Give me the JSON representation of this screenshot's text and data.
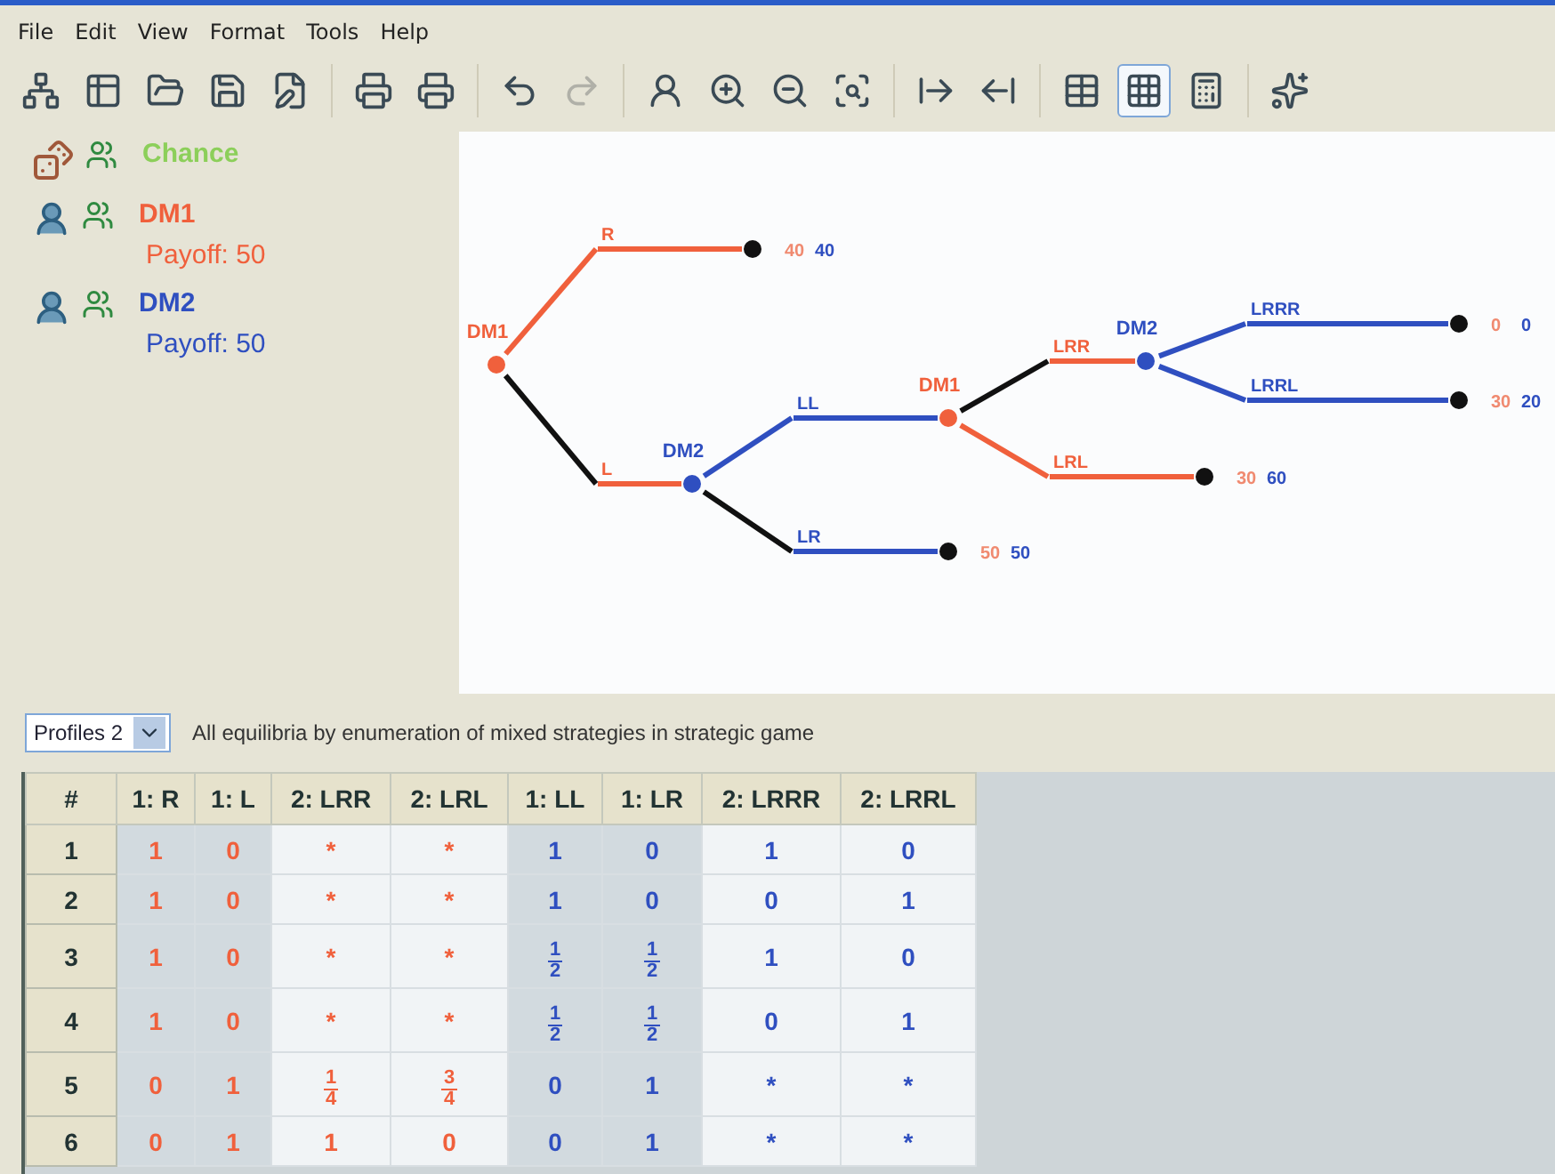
{
  "menu": [
    "File",
    "Edit",
    "View",
    "Format",
    "Tools",
    "Help"
  ],
  "toolbar": {
    "groups": [
      {
        "buttons": [
          {
            "kind": "logo",
            "selected": false,
            "disabled": false
          },
          {
            "kind": "new",
            "selected": false,
            "disabled": false
          },
          {
            "kind": "open",
            "selected": false,
            "disabled": false
          },
          {
            "kind": "save",
            "selected": false,
            "disabled": false
          },
          {
            "kind": "save-as",
            "selected": false,
            "disabled": false
          }
        ]
      },
      {
        "buttons": [
          {
            "kind": "print",
            "selected": false,
            "disabled": false
          },
          {
            "kind": "print-preview",
            "selected": false,
            "disabled": false
          }
        ]
      },
      {
        "buttons": [
          {
            "kind": "undo",
            "selected": false,
            "disabled": false
          },
          {
            "kind": "redo",
            "selected": false,
            "disabled": true
          }
        ]
      },
      {
        "buttons": [
          {
            "kind": "player",
            "selected": false,
            "disabled": false
          },
          {
            "kind": "zoom-in",
            "selected": false,
            "disabled": false
          },
          {
            "kind": "zoom-out",
            "selected": false,
            "disabled": false
          },
          {
            "kind": "zoom-fit",
            "selected": false,
            "disabled": false
          }
        ]
      },
      {
        "buttons": [
          {
            "kind": "decimals-more",
            "selected": false,
            "disabled": false
          },
          {
            "kind": "decimals-less",
            "selected": false,
            "disabled": false
          }
        ]
      },
      {
        "buttons": [
          {
            "kind": "table",
            "selected": false,
            "disabled": false
          },
          {
            "kind": "matrix",
            "selected": true,
            "disabled": false
          },
          {
            "kind": "calculator",
            "selected": false,
            "disabled": false
          }
        ]
      },
      {
        "buttons": [
          {
            "kind": "stars",
            "selected": false,
            "disabled": false
          }
        ]
      }
    ]
  },
  "players": [
    {
      "kind": "chance",
      "name": "Chance",
      "color": "#8ccf5a"
    },
    {
      "kind": "decision",
      "name": "DM1",
      "color": "#f0603c",
      "payoff": "Payoff: 50"
    },
    {
      "kind": "decision",
      "name": "DM2",
      "color": "#2f4fc0",
      "payoff": "Payoff: 50"
    }
  ],
  "tree": {
    "label": "DM1",
    "color": "#f0603c",
    "children": [
      {
        "move": "R",
        "color": "#f0603c",
        "highlighted": false,
        "payoffs": [
          {
            "text": "40",
            "color": "#f08a70"
          },
          {
            "text": "40",
            "color": "#2f4fc0"
          }
        ]
      },
      {
        "move": "L",
        "color": "#f0603c",
        "highlighted": true,
        "node": {
          "label": "DM2",
          "color": "#2f4fc0",
          "children": [
            {
              "move": "LL",
              "color": "#2f4fc0",
              "highlighted": false,
              "node": {
                "label": "DM1",
                "color": "#f0603c",
                "children": [
                  {
                    "move": "LRR",
                    "color": "#f0603c",
                    "highlighted": true,
                    "node": {
                      "label": "DM2",
                      "color": "#2f4fc0",
                      "children": [
                        {
                          "move": "LRRR",
                          "color": "#2f4fc0",
                          "highlighted": false,
                          "payoffs": [
                            {
                              "text": "0",
                              "color": "#f08a70"
                            },
                            {
                              "text": "0",
                              "color": "#2f4fc0"
                            }
                          ]
                        },
                        {
                          "move": "LRRL",
                          "color": "#2f4fc0",
                          "highlighted": false,
                          "payoffs": [
                            {
                              "text": "30",
                              "color": "#f08a70"
                            },
                            {
                              "text": "20",
                              "color": "#2f4fc0"
                            }
                          ]
                        }
                      ]
                    }
                  },
                  {
                    "move": "LRL",
                    "color": "#f0603c",
                    "highlighted": false,
                    "payoffs": [
                      {
                        "text": "30",
                        "color": "#f08a70"
                      },
                      {
                        "text": "60",
                        "color": "#2f4fc0"
                      }
                    ]
                  }
                ]
              }
            },
            {
              "move": "LR",
              "color": "#2f4fc0",
              "highlighted": true,
              "payoffs": [
                {
                  "text": "50",
                  "color": "#f08a70"
                },
                {
                  "text": "50",
                  "color": "#2f4fc0"
                }
              ]
            }
          ]
        }
      }
    ]
  },
  "profiles": {
    "value": "Profiles 2",
    "description": "All equilibria by enumeration of mixed strategies in strategic game"
  },
  "table": {
    "columns": [
      {
        "label": "#"
      },
      {
        "label": "1: R",
        "color": "#f0603c",
        "shaded": true
      },
      {
        "label": "1: L",
        "color": "#f0603c",
        "shaded": true
      },
      {
        "label": "2: LRR",
        "color": "#f0603c",
        "shaded": false
      },
      {
        "label": "2: LRL",
        "color": "#f0603c",
        "shaded": false
      },
      {
        "label": "1: LL",
        "color": "#2f4fc0",
        "shaded": true
      },
      {
        "label": "1: LR",
        "color": "#2f4fc0",
        "shaded": true
      },
      {
        "label": "2: LRRR",
        "color": "#2f4fc0",
        "shaded": false
      },
      {
        "label": "2: LRRL",
        "color": "#2f4fc0",
        "shaded": false
      }
    ],
    "rows": [
      {
        "cells": [
          {
            "kind": "number",
            "text": "1"
          },
          {
            "kind": "plain",
            "text": "1"
          },
          {
            "kind": "plain",
            "text": "0"
          },
          {
            "kind": "plain",
            "text": "*"
          },
          {
            "kind": "plain",
            "text": "*"
          },
          {
            "kind": "plain",
            "text": "1"
          },
          {
            "kind": "plain",
            "text": "0"
          },
          {
            "kind": "plain",
            "text": "1"
          },
          {
            "kind": "plain",
            "text": "0"
          }
        ]
      },
      {
        "cells": [
          {
            "kind": "number",
            "text": "2"
          },
          {
            "kind": "plain",
            "text": "1"
          },
          {
            "kind": "plain",
            "text": "0"
          },
          {
            "kind": "plain",
            "text": "*"
          },
          {
            "kind": "plain",
            "text": "*"
          },
          {
            "kind": "plain",
            "text": "1"
          },
          {
            "kind": "plain",
            "text": "0"
          },
          {
            "kind": "plain",
            "text": "0"
          },
          {
            "kind": "plain",
            "text": "1"
          }
        ]
      },
      {
        "cells": [
          {
            "kind": "number",
            "text": "3"
          },
          {
            "kind": "plain",
            "text": "1"
          },
          {
            "kind": "plain",
            "text": "0"
          },
          {
            "kind": "plain",
            "text": "*"
          },
          {
            "kind": "plain",
            "text": "*"
          },
          {
            "kind": "fraction",
            "num": "1",
            "den": "2"
          },
          {
            "kind": "fraction",
            "num": "1",
            "den": "2"
          },
          {
            "kind": "plain",
            "text": "1"
          },
          {
            "kind": "plain",
            "text": "0"
          }
        ]
      },
      {
        "cells": [
          {
            "kind": "number",
            "text": "4"
          },
          {
            "kind": "plain",
            "text": "1"
          },
          {
            "kind": "plain",
            "text": "0"
          },
          {
            "kind": "plain",
            "text": "*"
          },
          {
            "kind": "plain",
            "text": "*"
          },
          {
            "kind": "fraction",
            "num": "1",
            "den": "2"
          },
          {
            "kind": "fraction",
            "num": "1",
            "den": "2"
          },
          {
            "kind": "plain",
            "text": "0"
          },
          {
            "kind": "plain",
            "text": "1"
          }
        ]
      },
      {
        "cells": [
          {
            "kind": "number",
            "text": "5"
          },
          {
            "kind": "plain",
            "text": "0"
          },
          {
            "kind": "plain",
            "text": "1"
          },
          {
            "kind": "fraction",
            "num": "1",
            "den": "4"
          },
          {
            "kind": "fraction",
            "num": "3",
            "den": "4"
          },
          {
            "kind": "plain",
            "text": "0"
          },
          {
            "kind": "plain",
            "text": "1"
          },
          {
            "kind": "plain",
            "text": "*"
          },
          {
            "kind": "plain",
            "text": "*"
          }
        ]
      },
      {
        "cells": [
          {
            "kind": "number",
            "text": "6"
          },
          {
            "kind": "plain",
            "text": "0"
          },
          {
            "kind": "plain",
            "text": "1"
          },
          {
            "kind": "plain",
            "text": "1"
          },
          {
            "kind": "plain",
            "text": "0"
          },
          {
            "kind": "plain",
            "text": "0"
          },
          {
            "kind": "plain",
            "text": "1"
          },
          {
            "kind": "plain",
            "text": "*"
          },
          {
            "kind": "plain",
            "text": "*"
          }
        ]
      }
    ]
  }
}
